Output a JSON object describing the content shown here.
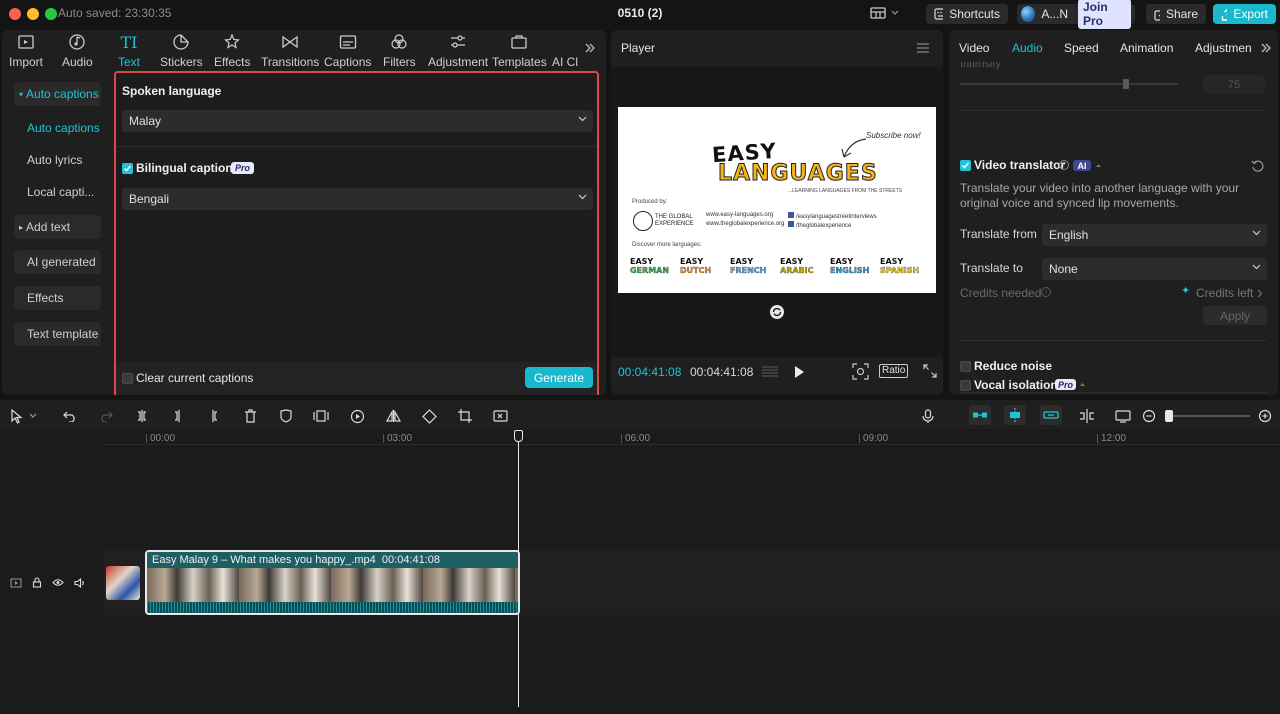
{
  "titlebar": {
    "autosave": "Auto saved: 23:30:35",
    "project_name": "0510 (2)",
    "shortcuts": "Shortcuts",
    "user": "A...N",
    "join_pro": "Join Pro",
    "share": "Share",
    "export": "Export"
  },
  "toolbar": {
    "tools": [
      {
        "label": "Import",
        "icon": "import-icon"
      },
      {
        "label": "Audio",
        "icon": "audio-icon"
      },
      {
        "label": "Text",
        "icon": "text-icon"
      },
      {
        "label": "Stickers",
        "icon": "stickers-icon"
      },
      {
        "label": "Effects",
        "icon": "effects-icon"
      },
      {
        "label": "Transitions",
        "icon": "transitions-icon"
      },
      {
        "label": "Captions",
        "icon": "captions-icon"
      },
      {
        "label": "Filters",
        "icon": "filters-icon"
      },
      {
        "label": "Adjustment",
        "icon": "adjustment-icon"
      },
      {
        "label": "Templates",
        "icon": "templates-icon"
      },
      {
        "label": "AI Cl",
        "icon": ""
      }
    ],
    "active": "Text"
  },
  "sidebar": {
    "items": [
      "Auto captions",
      "Auto captions",
      "Auto lyrics",
      "Local capti...",
      "Add text",
      "AI generated",
      "Effects",
      "Text template"
    ]
  },
  "captions_panel": {
    "spoken_language_label": "Spoken language",
    "spoken_language_value": "Malay",
    "bilingual_label": "Bilingual captions",
    "bilingual_badge": "Pro",
    "bilingual_checked": true,
    "bilingual_value": "Bengali",
    "clear_label": "Clear current captions",
    "clear_checked": false,
    "generate": "Generate"
  },
  "player": {
    "title": "Player",
    "current_time": "00:04:41:08",
    "total_time": "00:04:41:08",
    "ratio": "Ratio",
    "frame": {
      "subscribe": "Subscribe now!",
      "logo_top": "EASY",
      "logo_bottom": "LANGUAGES",
      "tagline": "...LEARNING LANGUAGES FROM THE STREETS",
      "produced_by": "Produced by:",
      "org_name": "THE GLOBAL EXPERIENCE",
      "url1": "www.easy-languages.org",
      "url2": "www.theglobalexperience.org",
      "fb1": "/easylanguagestreetinterviews",
      "fb2": "/theglobalexperience",
      "discover": "Discover more languages:",
      "languages": [
        {
          "top": "EASY",
          "name": "GERMAN",
          "color": "#39b54a"
        },
        {
          "top": "EASY",
          "name": "DUTCH",
          "color": "#f7941d"
        },
        {
          "top": "EASY",
          "name": "FRENCH",
          "color": "#5aa9e6"
        },
        {
          "top": "EASY",
          "name": "ARABIC",
          "color": "#c8b400"
        },
        {
          "top": "EASY",
          "name": "ENGLISH",
          "color": "#2e9fd8"
        },
        {
          "top": "EASY",
          "name": "SPANISH",
          "color": "#f3d21c"
        }
      ]
    }
  },
  "inspector": {
    "tabs": [
      "Video",
      "Audio",
      "Speed",
      "Animation",
      "Adjustmen"
    ],
    "active_tab": "Audio",
    "intensity_label": "Intensity",
    "intensity_value": "75",
    "intensity_fraction": 0.75,
    "video_translator": "Video translator",
    "ai_badge": "AI",
    "translator_desc": "Translate your video into another language with your original voice and synced lip movements.",
    "translate_from_label": "Translate from",
    "translate_from_value": "English",
    "translate_to_label": "Translate to",
    "translate_to_value": "None",
    "credits_needed": "Credits needed",
    "credits_left": "Credits left",
    "apply": "Apply",
    "reduce_noise": "Reduce noise",
    "vocal_isolation": "Vocal isolation",
    "vocal_badge": "Pro"
  },
  "timeline": {
    "ruler": [
      "00:00",
      "03:00",
      "06:00",
      "09:00",
      "12:00"
    ],
    "clip_title": "Easy Malay 9 – What makes you happy_.mp4",
    "clip_duration": "00:04:41:08"
  },
  "colors": {
    "accent": "#21c3d6",
    "highlight_border": "#e04848",
    "clip_header": "#1e5f63"
  }
}
